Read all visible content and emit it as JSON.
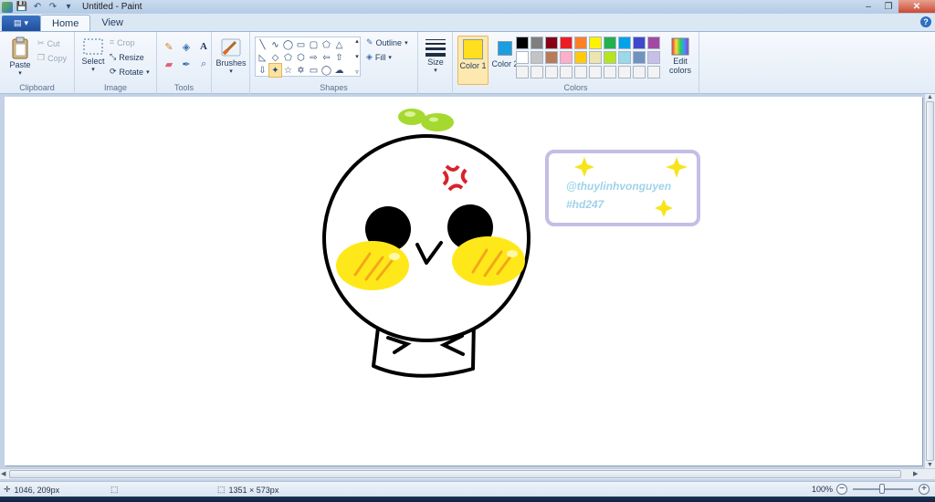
{
  "window": {
    "title": "Untitled - Paint",
    "controls": {
      "minimize": "–",
      "maximize": "❐",
      "close": "✕"
    }
  },
  "tabs": [
    {
      "label": "Home",
      "active": true
    },
    {
      "label": "View",
      "active": false
    }
  ],
  "help_label": "?",
  "ribbon": {
    "clipboard": {
      "label": "Clipboard",
      "paste": "Paste",
      "cut": "Cut",
      "copy": "Copy"
    },
    "image": {
      "label": "Image",
      "select": "Select",
      "crop": "Crop",
      "resize": "Resize",
      "rotate": "Rotate"
    },
    "tools": {
      "label": "Tools"
    },
    "brushes": {
      "label": "Brushes"
    },
    "shapes": {
      "label": "Shapes",
      "outline": "Outline",
      "fill": "Fill"
    },
    "size": {
      "label": "Size"
    },
    "colors": {
      "label": "Colors",
      "color1_label": "Color 1",
      "color2_label": "Color 2",
      "color1": "#ffdf1e",
      "color2": "#1a9ee0",
      "edit_colors": "Edit colors",
      "palette": [
        "#000000",
        "#7f7f7f",
        "#880015",
        "#ed1c24",
        "#ff7f27",
        "#fff200",
        "#22b14c",
        "#00a2e8",
        "#3f48cc",
        "#a349a4",
        "#ffffff",
        "#c3c3c3",
        "#b97a57",
        "#ffaec9",
        "#ffc90e",
        "#efe4b0",
        "#b5e61d",
        "#99d9ea",
        "#7092be",
        "#c8bfe7",
        "#f3f3f3",
        "#f3f3f3",
        "#f3f3f3",
        "#f3f3f3",
        "#f3f3f3",
        "#f3f3f3",
        "#f3f3f3",
        "#f3f3f3",
        "#f3f3f3",
        "#f3f3f3"
      ]
    }
  },
  "canvas": {
    "watermark_line1": "@thuylinhvonguyen",
    "watermark_line2": "#hd247"
  },
  "status": {
    "cursor_position": "1046, 209px",
    "image_size": "1351 × 573px",
    "zoom": "100%"
  }
}
